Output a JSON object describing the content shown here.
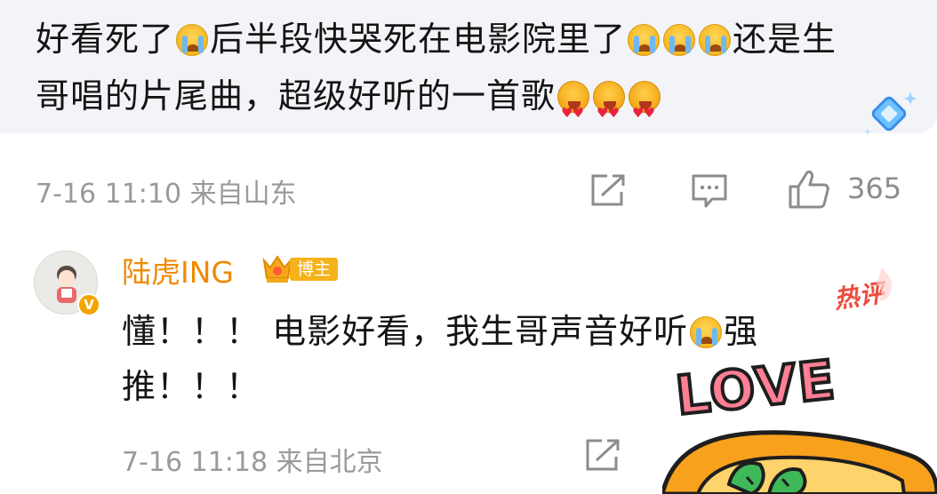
{
  "comment": {
    "segments": [
      {
        "t": "好看死了"
      },
      {
        "emoji": "cry-emoji"
      },
      {
        "t": "后半段快哭死在电影院里了"
      },
      {
        "emoji": "cry-emoji"
      },
      {
        "emoji": "cry-emoji"
      },
      {
        "emoji": "cry-emoji"
      },
      {
        "t": "还是生哥唱的片尾曲，超级好听的一首歌"
      },
      {
        "emoji": "heart-eyes-emoji"
      },
      {
        "emoji": "heart-eyes-emoji"
      },
      {
        "emoji": "heart-eyes-emoji"
      }
    ],
    "meta": "7-16 11:10 来自山东",
    "like_count": "365",
    "share_icon": "share-icon",
    "comment_icon": "comment-icon",
    "like_icon": "thumbs-up-icon"
  },
  "reply": {
    "username": "陆虎ING",
    "badge": "博主",
    "hot_tag": "热评",
    "segments": [
      {
        "t": "懂！！！ 电影好看，我生哥声音好听"
      },
      {
        "emoji": "cry-emoji"
      },
      {
        "t": "强推！！！"
      }
    ],
    "meta": "7-16 11:18 来自北京",
    "sticker_text": "LOVE"
  },
  "colors": {
    "username": "#f08a00",
    "badge_bg": "#f5b21a",
    "hot_tag": "#ef4b3e",
    "meta_text": "#9a9a9a",
    "card_bg": "#f3f4f8",
    "sticker_pink": "#ff7f95",
    "sticker_orange": "#f7a11d",
    "sticker_green": "#3fb85a"
  }
}
